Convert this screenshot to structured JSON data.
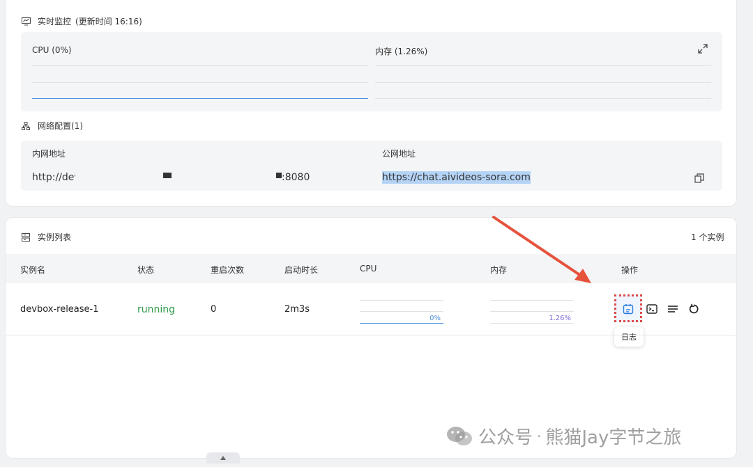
{
  "monitor": {
    "title": "实时监控",
    "updated": "(更新时间 16:16)",
    "cpu_label": "CPU  (0%)",
    "mem_label": "内存  (1.26%)"
  },
  "network": {
    "title": "网络配置(1)",
    "col_internal": "内网地址",
    "col_public": "公网地址",
    "internal_prefix": "http://dev",
    "internal_suffix": ":8080",
    "public_url": "https://chat.aivideos-sora.com"
  },
  "instances": {
    "title": "实例列表",
    "count": "1 个实例",
    "columns": [
      "实例名",
      "状态",
      "重启次数",
      "启动时长",
      "CPU",
      "内存",
      "操作"
    ],
    "rows": [
      {
        "name": "devbox-release-1",
        "status": "running",
        "restarts": "0",
        "uptime": "2m3s",
        "cpu": "0%",
        "mem": "1.26%"
      }
    ],
    "tooltip": "日志"
  },
  "watermark": {
    "prefix": "公众号",
    "dot": "·",
    "name": "熊猫Jay字节之旅"
  },
  "colors": {
    "running": "#2e9a4a",
    "cpu_line": "#4a90e2",
    "mem_line": "#7a6bd8",
    "arrow": "#e5533d"
  }
}
